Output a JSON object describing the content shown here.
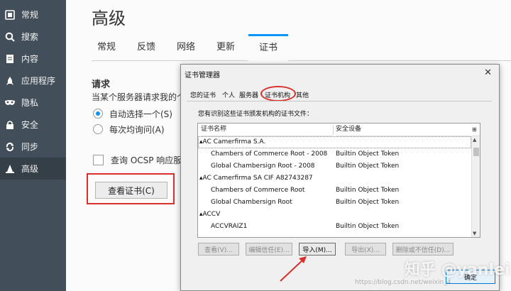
{
  "sidebar": {
    "items": [
      {
        "label": "常规",
        "icon": "general-icon"
      },
      {
        "label": "搜索",
        "icon": "search-icon"
      },
      {
        "label": "内容",
        "icon": "document-icon"
      },
      {
        "label": "应用程序",
        "icon": "rocket-icon"
      },
      {
        "label": "隐私",
        "icon": "mask-icon"
      },
      {
        "label": "安全",
        "icon": "lock-icon"
      },
      {
        "label": "同步",
        "icon": "sync-icon"
      },
      {
        "label": "高级",
        "icon": "wizard-hat-icon"
      }
    ],
    "active_index": 7
  },
  "main": {
    "title": "高级",
    "tabs": [
      "常规",
      "反馈",
      "网络",
      "更新",
      "证书"
    ],
    "selected_tab": 4,
    "requests_title": "请求",
    "requests_desc": "当某个服务器请求我的个",
    "radio_auto": "自动选择一个(S)",
    "radio_ask": "每次均询问(A)",
    "ocsp_label": "查询 OCSP 响应服务",
    "view_certs_button": "查看证书(C)"
  },
  "dialog": {
    "title": "证书管理器",
    "close": "✕",
    "tabs": [
      "您的证书",
      "个人",
      "服务器",
      "证书机构",
      "其他"
    ],
    "selected_tab": 3,
    "description": "您有识别这些证书颁发机构的证书文件：",
    "columns": [
      "证书名称",
      "安全设备"
    ],
    "rows": [
      {
        "name": "▴AC Camerfirma S.A.",
        "device": "",
        "group": true
      },
      {
        "name": "Chambers of Commerce Root - 2008",
        "device": "Builtin Object Token",
        "group": false
      },
      {
        "name": "Global Chambersign Root - 2008",
        "device": "Builtin Object Token",
        "group": false
      },
      {
        "name": "▴AC Camerfirma SA CIF A82743287",
        "device": "",
        "group": true
      },
      {
        "name": "Chambers of Commerce Root",
        "device": "Builtin Object Token",
        "group": false
      },
      {
        "name": "Global Chambersign Root",
        "device": "Builtin Object Token",
        "group": false
      },
      {
        "name": "▴ACCV",
        "device": "",
        "group": true
      },
      {
        "name": "ACCVRAIZ1",
        "device": "Builtin Object Token",
        "group": false
      }
    ],
    "buttons": {
      "view": "查看(V)...",
      "edit_trust": "编辑信任(E)...",
      "import": "导入(M)...",
      "export": "导出(X)...",
      "delete": "删除或不信任(D)..."
    },
    "ok": "确定"
  },
  "watermark": "知乎 @yanlei",
  "watermark_url": "https://blog.csdn.net/weixin_4..."
}
